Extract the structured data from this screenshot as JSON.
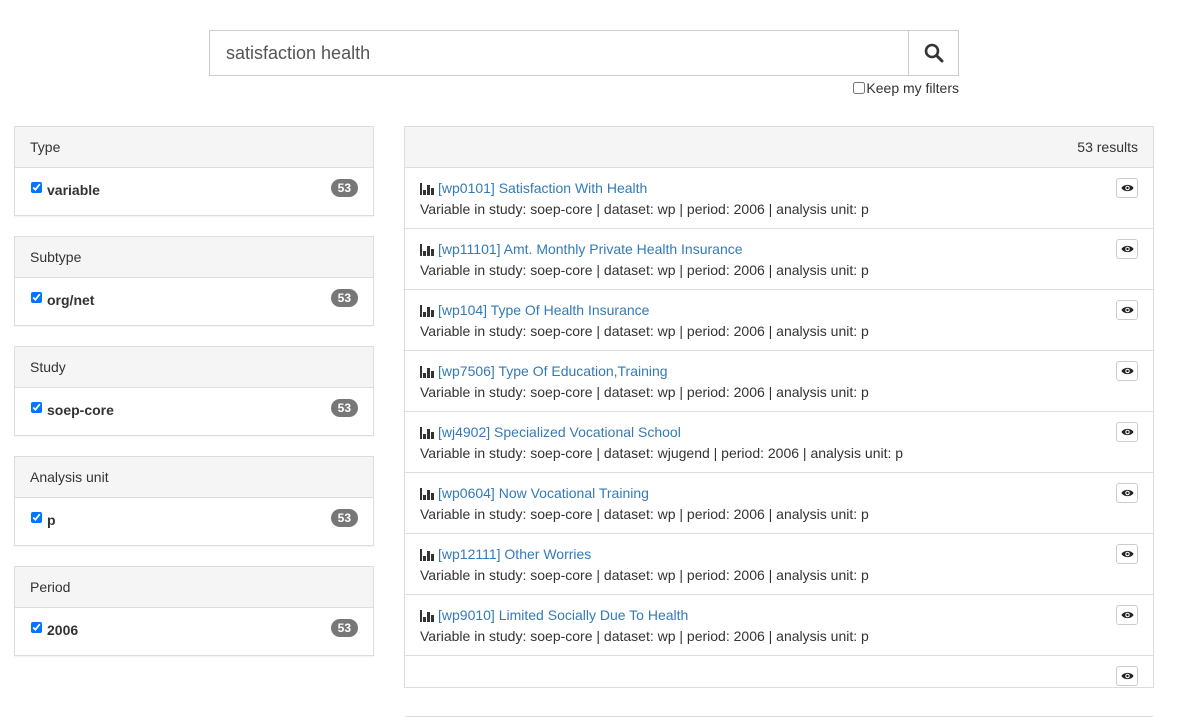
{
  "search": {
    "query": "satisfaction health",
    "keep_filters_label": "Keep my filters",
    "keep_filters_checked": false
  },
  "facets": [
    {
      "heading": "Type",
      "option": "variable",
      "count": "53",
      "checked": true
    },
    {
      "heading": "Subtype",
      "option": "org/net",
      "count": "53",
      "checked": true
    },
    {
      "heading": "Study",
      "option": "soep-core",
      "count": "53",
      "checked": true
    },
    {
      "heading": "Analysis unit",
      "option": "p",
      "count": "53",
      "checked": true
    },
    {
      "heading": "Period",
      "option": "2006",
      "count": "53",
      "checked": true
    }
  ],
  "results": {
    "count_label": "53 results",
    "items": [
      {
        "title": "[wp0101] Satisfaction With Health",
        "meta": "Variable in study: soep-core | dataset: wp | period: 2006 | analysis unit: p"
      },
      {
        "title": "[wp11101] Amt. Monthly Private Health Insurance",
        "meta": "Variable in study: soep-core | dataset: wp | period: 2006 | analysis unit: p"
      },
      {
        "title": "[wp104] Type Of Health Insurance",
        "meta": "Variable in study: soep-core | dataset: wp | period: 2006 | analysis unit: p"
      },
      {
        "title": "[wp7506] Type Of Education,Training",
        "meta": "Variable in study: soep-core | dataset: wp | period: 2006 | analysis unit: p"
      },
      {
        "title": "[wj4902] Specialized Vocational School",
        "meta": "Variable in study: soep-core | dataset: wjugend | period: 2006 | analysis unit: p"
      },
      {
        "title": "[wp0604] Now Vocational Training",
        "meta": "Variable in study: soep-core | dataset: wp | period: 2006 | analysis unit: p"
      },
      {
        "title": "[wp12111] Other Worries",
        "meta": "Variable in study: soep-core | dataset: wp | period: 2006 | analysis unit: p"
      },
      {
        "title": "[wp9010] Limited Socially Due To Health",
        "meta": "Variable in study: soep-core | dataset: wp | period: 2006 | analysis unit: p"
      },
      {
        "title": "",
        "meta": ""
      }
    ]
  },
  "icons": {
    "search": "search-icon",
    "bar_chart": "bar-chart-icon",
    "eye": "eye-icon"
  },
  "colors": {
    "link": "#337ab7",
    "badge": "#777777",
    "panel_heading": "#f5f5f5",
    "border": "#dddddd"
  }
}
